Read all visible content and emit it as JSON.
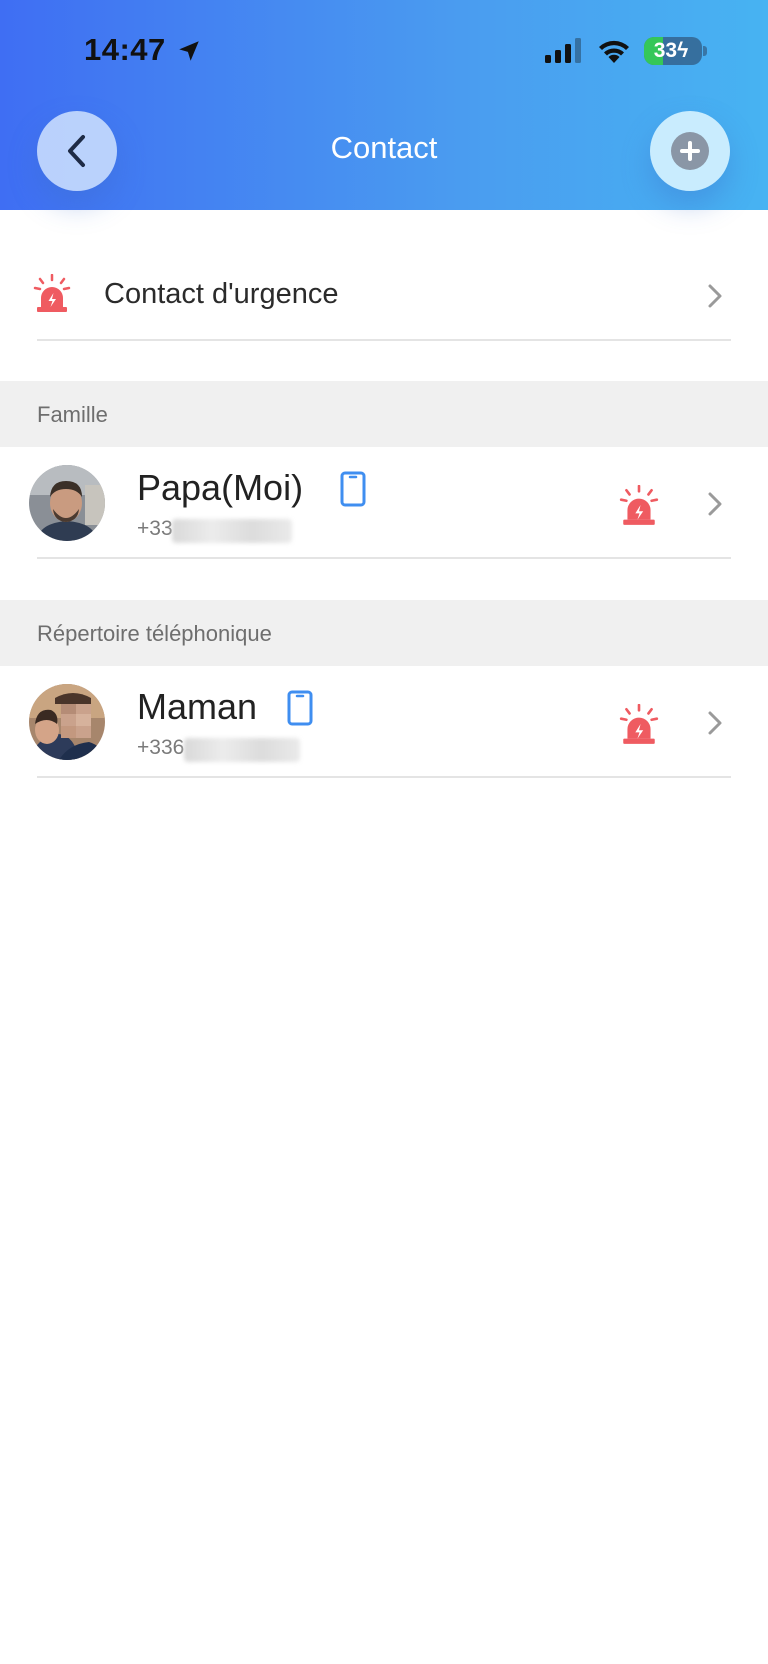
{
  "status_bar": {
    "time": "14:47",
    "battery_level": "33",
    "battery_fraction": 0.33,
    "icons": [
      "location-arrow-icon",
      "cellular-signal-icon",
      "wifi-icon",
      "battery-charging-icon"
    ]
  },
  "header": {
    "title": "Contact",
    "back_icon": "chevron-left-icon",
    "add_icon": "plus-circle-icon"
  },
  "colors": {
    "header_gradient_start": "#3f6ef3",
    "header_gradient_end": "#47b3f2",
    "alarm_red": "#ef5b61",
    "phone_blue": "#3f8ef0",
    "section_bg": "#f0f0f0"
  },
  "emergency": {
    "label": "Contact d'urgence",
    "icon": "siren-icon"
  },
  "sections": [
    {
      "title": "Famille",
      "contacts": [
        {
          "name": "Papa(Moi)",
          "number_visible": "+33",
          "device_icon": "smartphone-icon",
          "alarm_icon": "siren-icon"
        }
      ]
    },
    {
      "title": "Répertoire téléphonique",
      "contacts": [
        {
          "name": "Maman",
          "number_visible": "+336",
          "device_icon": "smartphone-icon",
          "alarm_icon": "siren-icon"
        }
      ]
    }
  ]
}
